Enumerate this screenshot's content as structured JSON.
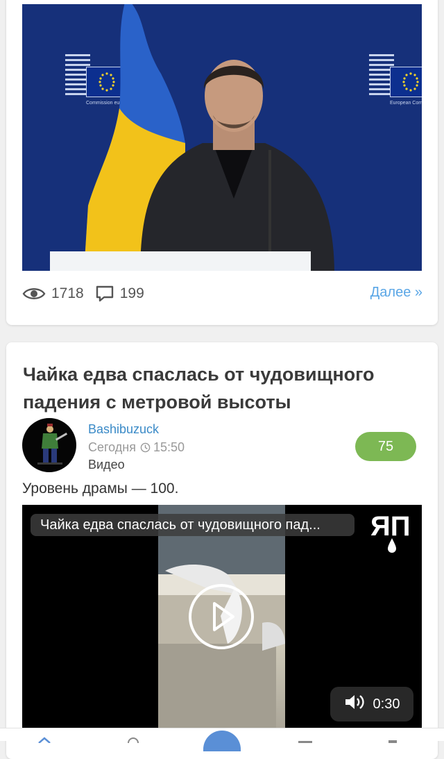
{
  "post1": {
    "views": "1718",
    "comments": "199",
    "more_label": "Далее »",
    "image_logo_text_left": "Commission européenne",
    "image_logo_text_right": "European Commission"
  },
  "post2": {
    "title": "Чайка едва спаслась от чудовищного падения с метровой высоты",
    "author": "Bashibuzuck",
    "date_prefix": "Сегодня",
    "time": "15:50",
    "section": "Видео",
    "rating": "75",
    "description": "Уровень драмы — 100.",
    "video": {
      "title": "Чайка едва спаслась от чудовищного пад...",
      "logo_text": "ЯП",
      "duration": "0:30"
    }
  },
  "colors": {
    "link": "#5aa6e6",
    "author": "#3a8ac7",
    "rating_bg": "#7db854",
    "nav_accent": "#5a8fd6"
  },
  "icons": {
    "views": "eye-icon",
    "comments": "comment-icon",
    "clock": "clock-icon",
    "play": "play-icon",
    "volume": "volume-icon",
    "nav": [
      "chevron-up-icon",
      "search-icon",
      "add-post-icon",
      "feed-icon",
      "profile-icon"
    ]
  }
}
